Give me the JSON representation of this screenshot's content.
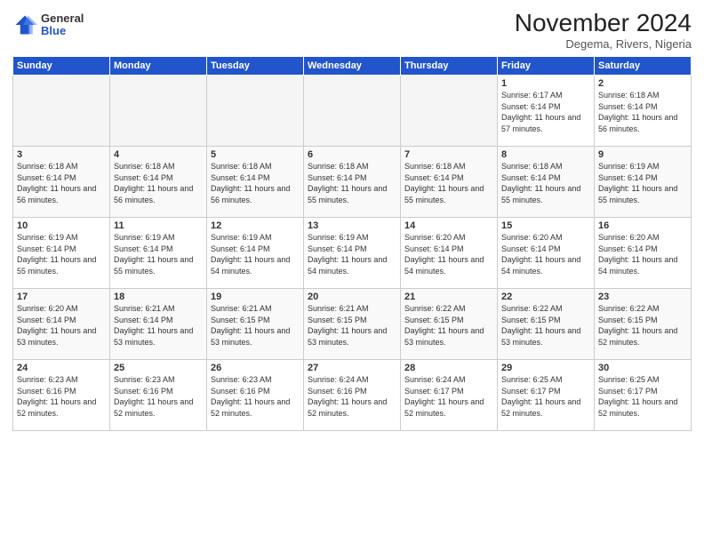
{
  "header": {
    "logo_general": "General",
    "logo_blue": "Blue",
    "month_title": "November 2024",
    "subtitle": "Degema, Rivers, Nigeria"
  },
  "weekdays": [
    "Sunday",
    "Monday",
    "Tuesday",
    "Wednesday",
    "Thursday",
    "Friday",
    "Saturday"
  ],
  "weeks": [
    [
      {
        "day": "",
        "info": ""
      },
      {
        "day": "",
        "info": ""
      },
      {
        "day": "",
        "info": ""
      },
      {
        "day": "",
        "info": ""
      },
      {
        "day": "",
        "info": ""
      },
      {
        "day": "1",
        "info": "Sunrise: 6:17 AM\nSunset: 6:14 PM\nDaylight: 11 hours\nand 57 minutes."
      },
      {
        "day": "2",
        "info": "Sunrise: 6:18 AM\nSunset: 6:14 PM\nDaylight: 11 hours\nand 56 minutes."
      }
    ],
    [
      {
        "day": "3",
        "info": "Sunrise: 6:18 AM\nSunset: 6:14 PM\nDaylight: 11 hours\nand 56 minutes."
      },
      {
        "day": "4",
        "info": "Sunrise: 6:18 AM\nSunset: 6:14 PM\nDaylight: 11 hours\nand 56 minutes."
      },
      {
        "day": "5",
        "info": "Sunrise: 6:18 AM\nSunset: 6:14 PM\nDaylight: 11 hours\nand 56 minutes."
      },
      {
        "day": "6",
        "info": "Sunrise: 6:18 AM\nSunset: 6:14 PM\nDaylight: 11 hours\nand 55 minutes."
      },
      {
        "day": "7",
        "info": "Sunrise: 6:18 AM\nSunset: 6:14 PM\nDaylight: 11 hours\nand 55 minutes."
      },
      {
        "day": "8",
        "info": "Sunrise: 6:18 AM\nSunset: 6:14 PM\nDaylight: 11 hours\nand 55 minutes."
      },
      {
        "day": "9",
        "info": "Sunrise: 6:19 AM\nSunset: 6:14 PM\nDaylight: 11 hours\nand 55 minutes."
      }
    ],
    [
      {
        "day": "10",
        "info": "Sunrise: 6:19 AM\nSunset: 6:14 PM\nDaylight: 11 hours\nand 55 minutes."
      },
      {
        "day": "11",
        "info": "Sunrise: 6:19 AM\nSunset: 6:14 PM\nDaylight: 11 hours\nand 55 minutes."
      },
      {
        "day": "12",
        "info": "Sunrise: 6:19 AM\nSunset: 6:14 PM\nDaylight: 11 hours\nand 54 minutes."
      },
      {
        "day": "13",
        "info": "Sunrise: 6:19 AM\nSunset: 6:14 PM\nDaylight: 11 hours\nand 54 minutes."
      },
      {
        "day": "14",
        "info": "Sunrise: 6:20 AM\nSunset: 6:14 PM\nDaylight: 11 hours\nand 54 minutes."
      },
      {
        "day": "15",
        "info": "Sunrise: 6:20 AM\nSunset: 6:14 PM\nDaylight: 11 hours\nand 54 minutes."
      },
      {
        "day": "16",
        "info": "Sunrise: 6:20 AM\nSunset: 6:14 PM\nDaylight: 11 hours\nand 54 minutes."
      }
    ],
    [
      {
        "day": "17",
        "info": "Sunrise: 6:20 AM\nSunset: 6:14 PM\nDaylight: 11 hours\nand 53 minutes."
      },
      {
        "day": "18",
        "info": "Sunrise: 6:21 AM\nSunset: 6:14 PM\nDaylight: 11 hours\nand 53 minutes."
      },
      {
        "day": "19",
        "info": "Sunrise: 6:21 AM\nSunset: 6:15 PM\nDaylight: 11 hours\nand 53 minutes."
      },
      {
        "day": "20",
        "info": "Sunrise: 6:21 AM\nSunset: 6:15 PM\nDaylight: 11 hours\nand 53 minutes."
      },
      {
        "day": "21",
        "info": "Sunrise: 6:22 AM\nSunset: 6:15 PM\nDaylight: 11 hours\nand 53 minutes."
      },
      {
        "day": "22",
        "info": "Sunrise: 6:22 AM\nSunset: 6:15 PM\nDaylight: 11 hours\nand 53 minutes."
      },
      {
        "day": "23",
        "info": "Sunrise: 6:22 AM\nSunset: 6:15 PM\nDaylight: 11 hours\nand 52 minutes."
      }
    ],
    [
      {
        "day": "24",
        "info": "Sunrise: 6:23 AM\nSunset: 6:16 PM\nDaylight: 11 hours\nand 52 minutes."
      },
      {
        "day": "25",
        "info": "Sunrise: 6:23 AM\nSunset: 6:16 PM\nDaylight: 11 hours\nand 52 minutes."
      },
      {
        "day": "26",
        "info": "Sunrise: 6:23 AM\nSunset: 6:16 PM\nDaylight: 11 hours\nand 52 minutes."
      },
      {
        "day": "27",
        "info": "Sunrise: 6:24 AM\nSunset: 6:16 PM\nDaylight: 11 hours\nand 52 minutes."
      },
      {
        "day": "28",
        "info": "Sunrise: 6:24 AM\nSunset: 6:17 PM\nDaylight: 11 hours\nand 52 minutes."
      },
      {
        "day": "29",
        "info": "Sunrise: 6:25 AM\nSunset: 6:17 PM\nDaylight: 11 hours\nand 52 minutes."
      },
      {
        "day": "30",
        "info": "Sunrise: 6:25 AM\nSunset: 6:17 PM\nDaylight: 11 hours\nand 52 minutes."
      }
    ]
  ]
}
